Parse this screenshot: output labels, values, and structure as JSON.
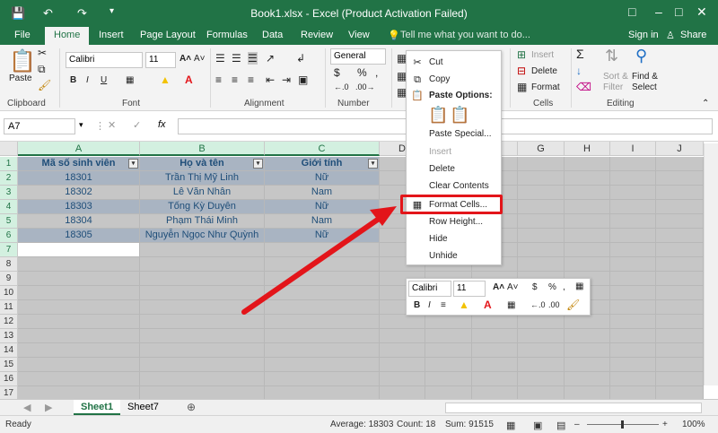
{
  "window": {
    "title": "Book1.xlsx - Excel (Product Activation Failed)",
    "save_icon": "save-icon",
    "undo_icon": "undo-icon",
    "redo_icon": "redo-icon"
  },
  "ribbon_tabs": [
    "File",
    "Home",
    "Insert",
    "Page Layout",
    "Formulas",
    "Data",
    "Review",
    "View"
  ],
  "tell_me": "Tell me what you want to do...",
  "signin": "Sign in",
  "share": "Share",
  "ribbon": {
    "paste": "Paste",
    "clipboard": "Clipboard",
    "font": "Font",
    "alignment": "Alignment",
    "number": "Number",
    "cells": "Cells",
    "editing": "Editing",
    "font_name": "Calibri",
    "font_size": "11",
    "number_format": "General",
    "insert": "Insert",
    "delete": "Delete",
    "format": "Format",
    "sort_filter": "Sort &",
    "sort_filter2": "Filter",
    "find_select": "Find &",
    "find_select2": "Select"
  },
  "formula_bar": {
    "name_box": "A7",
    "fx": "fx"
  },
  "columns": [
    "A",
    "B",
    "C",
    "D",
    "E",
    "F",
    "G",
    "H",
    "I",
    "J"
  ],
  "rows": [
    "1",
    "2",
    "3",
    "4",
    "5",
    "6",
    "7",
    "8",
    "9",
    "10",
    "11",
    "12",
    "13",
    "14",
    "15",
    "16",
    "17"
  ],
  "table": {
    "headers": [
      "Mã số sinh viên",
      "Họ và tên",
      "Giới tính"
    ],
    "data": [
      [
        "18301",
        "Trần Thị Mỹ Linh",
        "Nữ"
      ],
      [
        "18302",
        "Lê Văn Nhân",
        "Nam"
      ],
      [
        "18303",
        "Tống Kỳ Duyên",
        "Nữ"
      ],
      [
        "18304",
        "Phạm Thái Minh",
        "Nam"
      ],
      [
        "18305",
        "Nguyễn Ngọc Như Quỳnh",
        "Nữ"
      ]
    ]
  },
  "context_menu": {
    "cut": "Cut",
    "copy": "Copy",
    "paste_options": "Paste Options:",
    "paste_special": "Paste Special...",
    "insert": "Insert",
    "delete": "Delete",
    "clear_contents": "Clear Contents",
    "format_cells": "Format Cells...",
    "row_height": "Row Height...",
    "hide": "Hide",
    "unhide": "Unhide"
  },
  "mini_toolbar": {
    "font_name": "Calibri",
    "font_size": "11"
  },
  "sheets": [
    "Sheet1",
    "Sheet7"
  ],
  "status": {
    "ready": "Ready",
    "average": "Average: 18303",
    "count": "Count: 18",
    "sum": "Sum: 91515",
    "zoom": "100%"
  },
  "colors": {
    "accent": "#217346",
    "highlight_box": "#e3151a",
    "arrow": "#e3151a"
  }
}
